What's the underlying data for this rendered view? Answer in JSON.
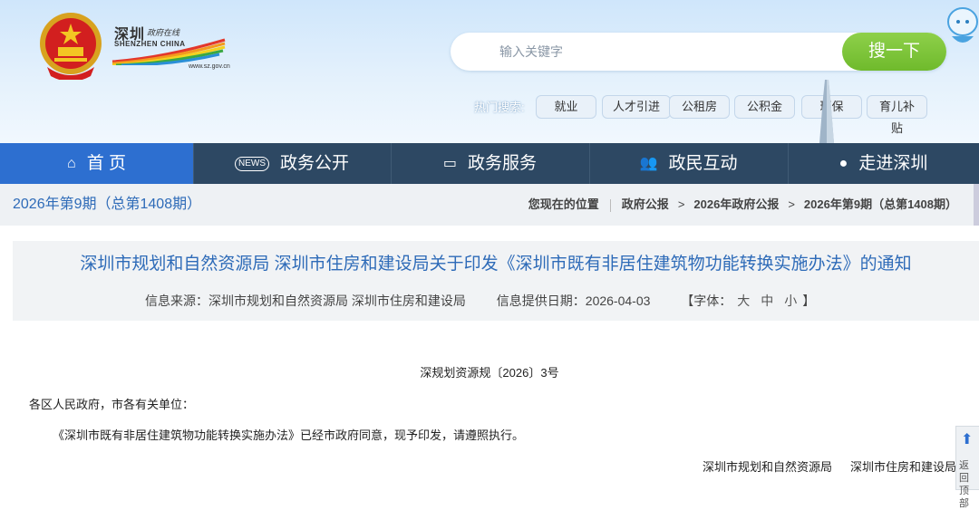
{
  "header": {
    "logo": {
      "cn": "深圳",
      "cn2": "政府在线",
      "en": "SHENZHEN CHINA",
      "url": "www.sz.gov.cn"
    },
    "search": {
      "placeholder": "输入关键字",
      "button": "搜一下"
    },
    "hot_label": "热门搜索:",
    "hot_tags": [
      "就业",
      "人才引进",
      "公租房",
      "公积金",
      "环保",
      "育儿补贴"
    ]
  },
  "nav": {
    "items": [
      {
        "label": "首 页",
        "icon": "home-icon"
      },
      {
        "label": "政务公开",
        "icon": "news-icon"
      },
      {
        "label": "政务服务",
        "icon": "monitor-icon"
      },
      {
        "label": "政民互动",
        "icon": "people-icon"
      },
      {
        "label": "走进深圳",
        "icon": "chat-icon"
      }
    ]
  },
  "issue": {
    "title": "2026年第9期（总第1408期）",
    "breadcrumb": {
      "label": "您现在的位置",
      "items": [
        "政府公报",
        "2026年政府公报",
        "2026年第9期（总第1408期）"
      ]
    }
  },
  "article": {
    "title": "深圳市规划和自然资源局 深圳市住房和建设局关于印发《深圳市既有非居住建筑物功能转换实施办法》的通知",
    "source": "信息来源：深圳市规划和自然资源局 深圳市住房和建设局",
    "date": "信息提供日期：2026-04-03",
    "font_label": "【字体：",
    "font_sizes": [
      "大",
      "中",
      "小"
    ],
    "font_end": "】",
    "doc_no": "深规划资源规〔2026〕3号",
    "salutation": "各区人民政府，市各有关单位：",
    "paragraph": "《深圳市既有非居住建筑物功能转换实施办法》已经市政府同意，现予印发，请遵照执行。",
    "signatures": [
      "深圳市规划和自然资源局",
      "深圳市住房和建设局"
    ]
  },
  "back_to_top": "返回顶部"
}
